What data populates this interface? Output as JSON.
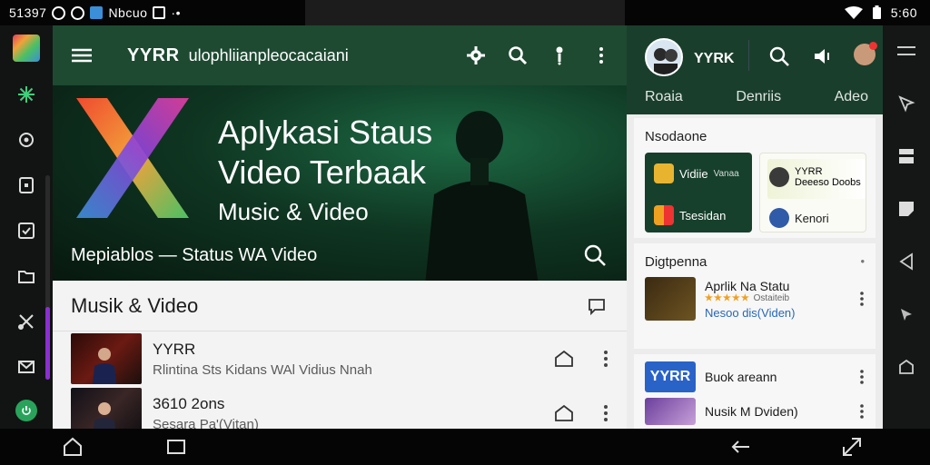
{
  "statusbar": {
    "time_left": "51397",
    "notif_text": "Nbcuo",
    "time_right": "5:60"
  },
  "leftnav": {
    "items": [
      "app-logo",
      "pinwheel-icon",
      "gear-icon",
      "tablet-icon",
      "checkbox-icon",
      "folder-icon",
      "scissors-icon",
      "mail-icon",
      "power-icon"
    ]
  },
  "main": {
    "appbar": {
      "brand": "YYRR",
      "subtitle": "ulophliianpleocacaiani"
    },
    "hero": {
      "title": "Aplykasi Staus Video Terbaak",
      "tagline": "Music & Video",
      "caption": "Mepiablos — Status WA Video"
    },
    "section": {
      "title": "Musik & Video"
    },
    "videos": [
      {
        "title": "YYRR",
        "subtitle": "Rlintina Sts Kidans WAl Vidius Nnah"
      },
      {
        "title": "3610 2ons",
        "subtitle": "Sesara Pa'(Vitan)"
      }
    ]
  },
  "right": {
    "brand": "YYRK",
    "tabs": [
      "Roaia",
      "Denriis",
      "Adeo"
    ],
    "card1": {
      "heading": "Nsodaone",
      "tile_dark": {
        "line1": "Vidiie",
        "line1_small": "Vanaa",
        "line2": "Tsesidan"
      },
      "tile_light": {
        "line1": "YYRR",
        "line2": "Deeeso Doobs",
        "line3": "Kenori"
      }
    },
    "card2": {
      "heading": "Digtpenna",
      "dots": "•",
      "item": {
        "title": "Aprlik Na Statu",
        "stars": "★★★★★",
        "stars_text": "Ostaiteib",
        "link": "Nesoo dis(Viden)"
      }
    },
    "card3": {
      "items": [
        {
          "title": "Buok areann",
          "thumb_text": "YYRR"
        },
        {
          "title": "Nusik M Dviden)"
        }
      ]
    }
  },
  "colors": {
    "appbar_green": "#1d4a31",
    "hero_green": "#0f3622",
    "accent_purple": "#8b2fd1",
    "link_blue": "#2767b8",
    "star_orange": "#f0a020"
  }
}
